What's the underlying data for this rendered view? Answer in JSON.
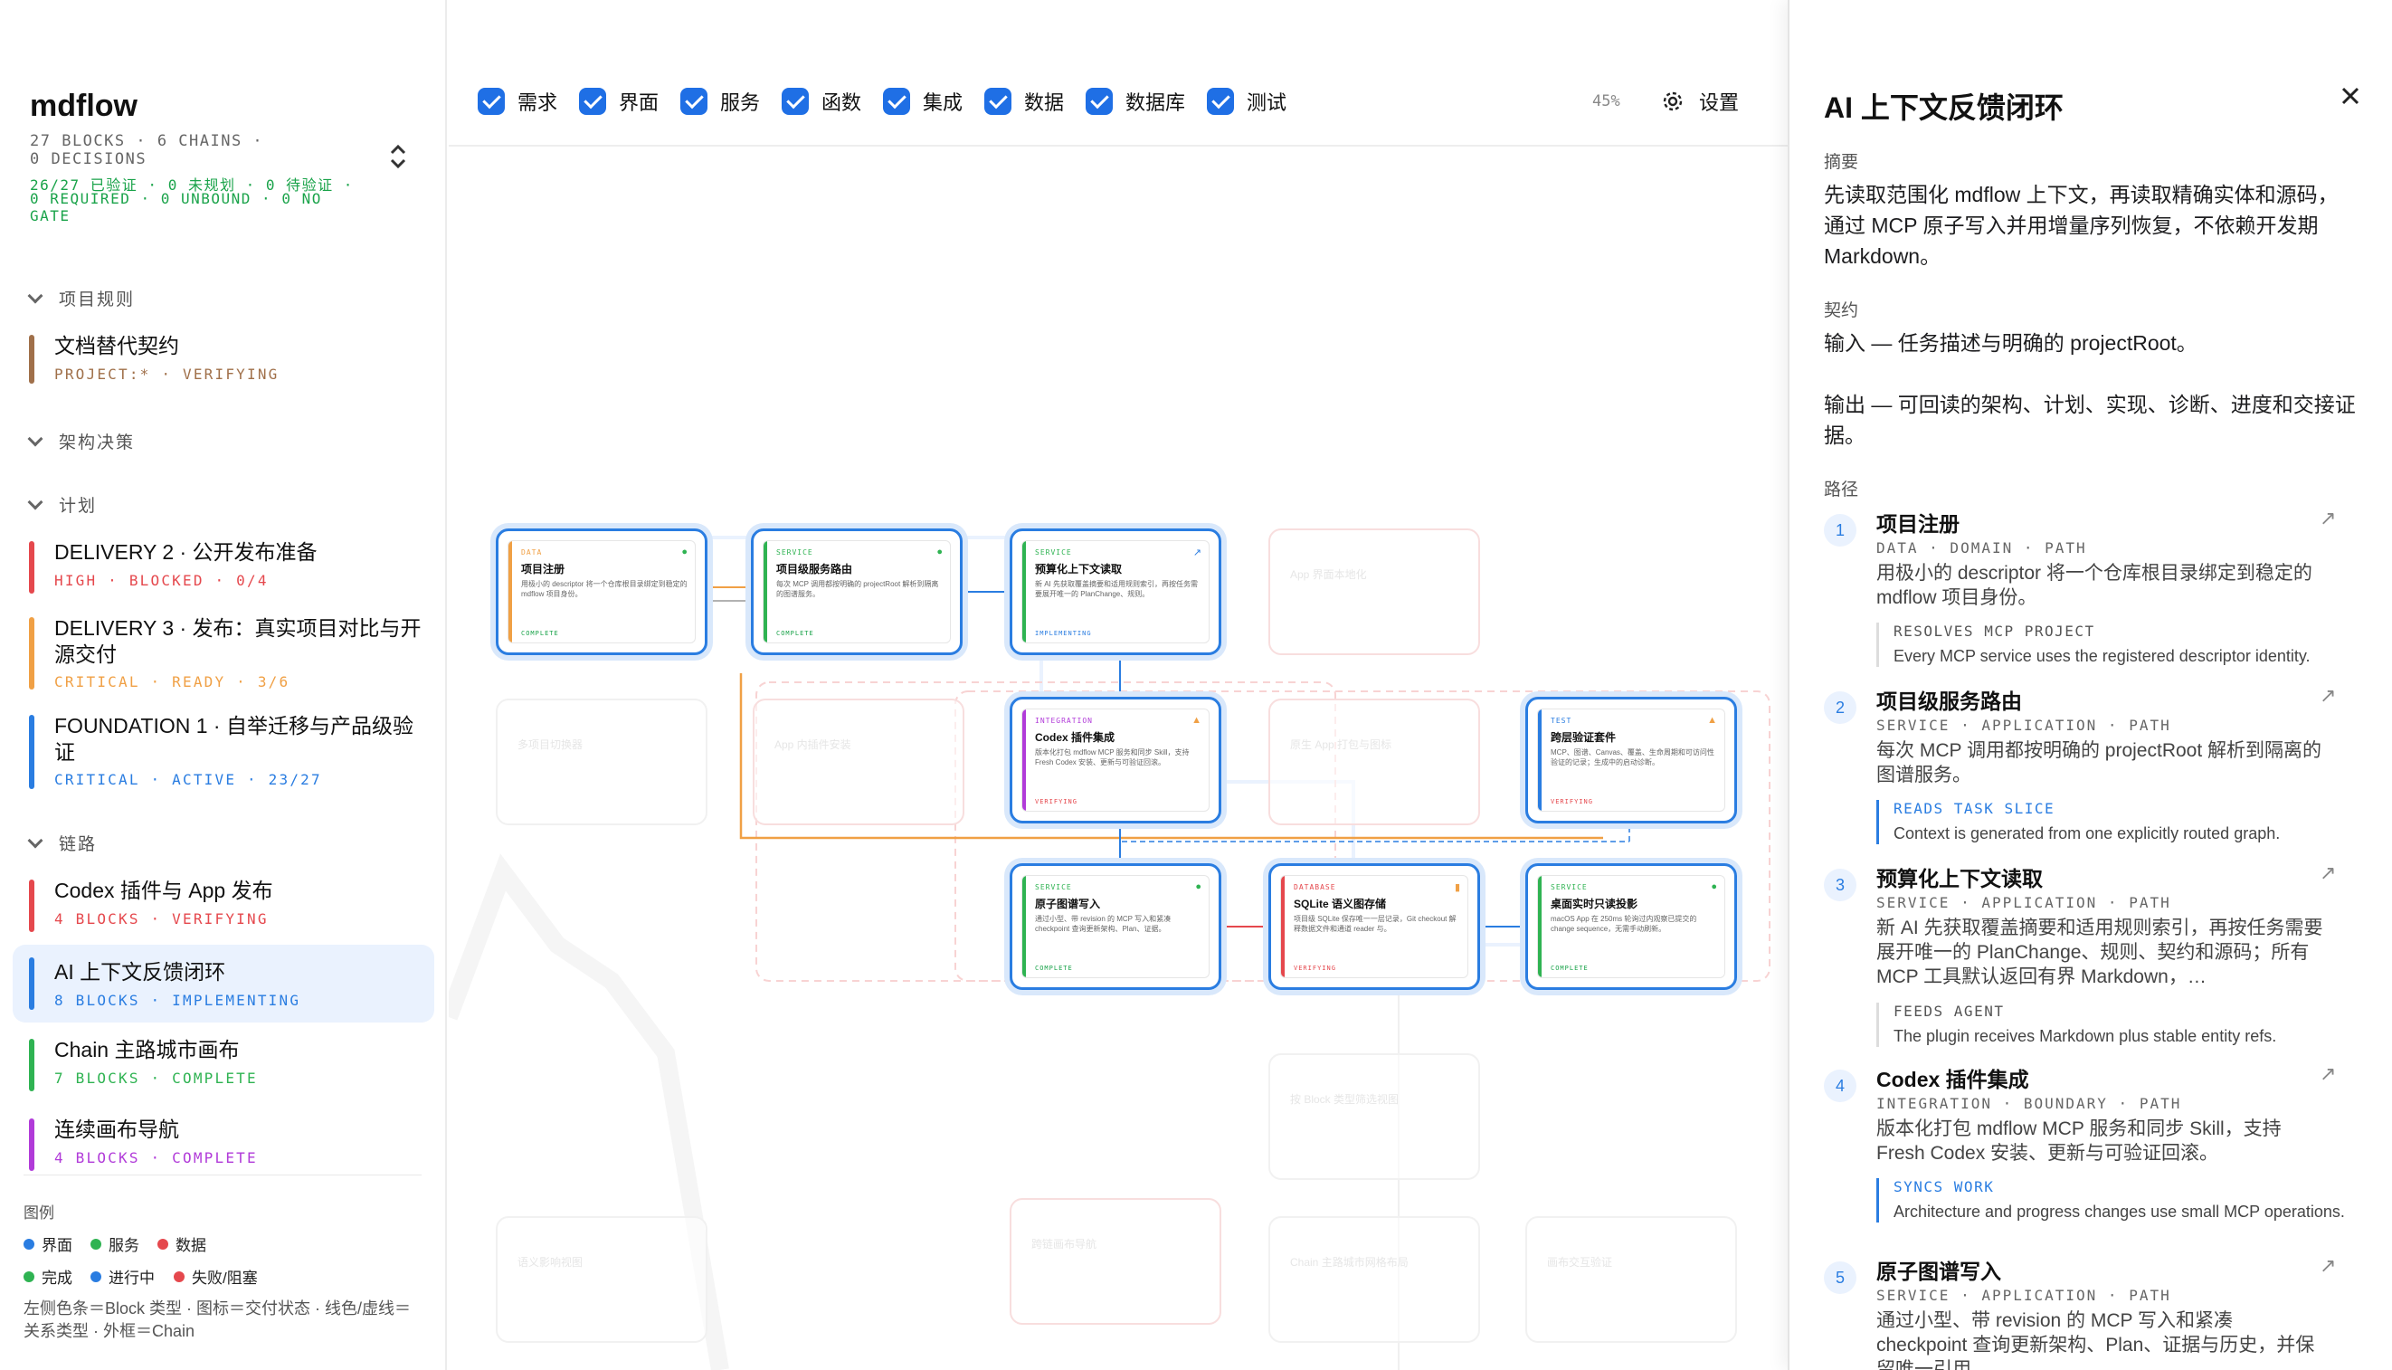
{
  "sidebar": {
    "title": "mdflow",
    "meta_line1": "27 BLOCKS · 6 CHAINS ·",
    "meta_line2": "0 DECISIONS",
    "status_line1": "26/27 已验证 · 0 未规划 · 0 待验证 ·",
    "status_line2": "0 REQUIRED · 0 UNBOUND · 0 NO",
    "status_line3": "GATE",
    "sections": {
      "rules": "项目规则",
      "decisions": "架构决策",
      "plan": "计划",
      "chains": "链路"
    },
    "rules_items": [
      {
        "title": "文档替代契约",
        "sub": "PROJECT:* · VERIFYING",
        "color": "#a0704a"
      }
    ],
    "plan_items": [
      {
        "title": "DELIVERY 2 · 公开发布准备",
        "sub": "HIGH · BLOCKED · 0/4",
        "color": "#e5484d"
      },
      {
        "title": "DELIVERY 3 · 发布：真实项目对比与开源交付",
        "sub": "CRITICAL · READY · 3/6",
        "color": "#f0a045"
      },
      {
        "title": "FOUNDATION 1 · 自举迁移与产品级验证",
        "sub": "CRITICAL · ACTIVE · 23/27",
        "color": "#2a7de1"
      }
    ],
    "chain_items": [
      {
        "title": "Codex 插件与 App 发布",
        "sub": "4 BLOCKS · VERIFYING",
        "color": "#e5484d"
      },
      {
        "title": "AI 上下文反馈闭环",
        "sub": "8 BLOCKS · IMPLEMENTING",
        "color": "#2a7de1"
      },
      {
        "title": "Chain 主路城市画布",
        "sub": "7 BLOCKS · COMPLETE",
        "color": "#2fb352"
      },
      {
        "title": "连续画布导航",
        "sub": "4 BLOCKS · COMPLETE",
        "color": "#b13bd9"
      }
    ],
    "legend": {
      "heading": "图例",
      "items": [
        {
          "label": "界面",
          "color": "#2a7de1"
        },
        {
          "label": "服务",
          "color": "#2fb352"
        },
        {
          "label": "数据",
          "color": "#e5484d"
        },
        {
          "label": "完成",
          "color": "#2fb352"
        },
        {
          "label": "进行中",
          "color": "#2a7de1"
        },
        {
          "label": "失败/阻塞",
          "color": "#e5484d"
        }
      ],
      "note": "左侧色条＝Block 类型 · 图标＝交付状态 · 线色/虚线＝关系类型 · 外框＝Chain"
    }
  },
  "toolbar": {
    "filters": [
      "需求",
      "界面",
      "服务",
      "函数",
      "集成",
      "数据",
      "数据库",
      "测试"
    ],
    "zoom": "45%",
    "settings_label": "设置"
  },
  "canvas": {
    "nodes": [
      {
        "type": "DATA",
        "name": "项目注册",
        "desc": "用极小的 descriptor 将一个仓库根目录绑定到稳定的 mdflow 项目身份。",
        "status": "COMPLETE",
        "color": "#f0a045"
      },
      {
        "type": "SERVICE",
        "name": "项目级服务路由",
        "desc": "每次 MCP 调用都按明确的 projectRoot 解析到隔离的图谱服务。",
        "status": "COMPLETE",
        "color": "#2fb352"
      },
      {
        "type": "SERVICE",
        "name": "预算化上下文读取",
        "desc": "新 AI 先获取覆盖摘要和适用规则索引，再按任务需要展开唯一的 PlanChange、规则。",
        "status": "IMPLEMENTING",
        "color": "#2fb352"
      },
      {
        "type": "INTEGRATION",
        "name": "Codex 插件集成",
        "desc": "版本化打包 mdflow MCP 服务和同步 Skill，支持 Fresh Codex 安装、更新与可验证回滚。",
        "status": "VERIFYING",
        "color": "#b13bd9"
      },
      {
        "type": "TEST",
        "name": "跨层验证套件",
        "desc": "MCP、图谱、Canvas、覆盖、生命周期和可访问性验证的记录；生成中的启动诊断。",
        "status": "VERIFYING",
        "color": "#2a7de1"
      },
      {
        "type": "SERVICE",
        "name": "原子图谱写入",
        "desc": "通过小型、带 revision 的 MCP 写入和紧凑 checkpoint 查询更新架构、Plan、证据。",
        "status": "COMPLETE",
        "color": "#2fb352"
      },
      {
        "type": "DATABASE",
        "name": "SQLite 语义图存储",
        "desc": "项目级 SQLite 保存唯一一层记录，Git checkout 解释数据文件和通道 reader 与。",
        "status": "VERIFYING",
        "color": "#e5484d"
      },
      {
        "type": "SERVICE",
        "name": "桌面实时只读投影",
        "desc": "macOS App 在 250ms 轮询过内观察已提交的 change sequence，无需手动刷新。",
        "status": "COMPLETE",
        "color": "#2fb352"
      }
    ]
  },
  "panel": {
    "title": "AI 上下文反馈闭环",
    "summary_label": "摘要",
    "summary": "先读取范围化 mdflow 上下文，再读取精确实体和源码，通过 MCP 原子写入并用增量序列恢复，不依赖开发期 Markdown。",
    "contract_label": "契约",
    "contract_in": "输入 — 任务描述与明确的 projectRoot。",
    "contract_out": "输出 — 可回读的架构、计划、实现、诊断、进度和交接证据。",
    "path_label": "路径",
    "steps": [
      {
        "num": "1",
        "name": "项目注册",
        "tag": "DATA · DOMAIN · PATH",
        "desc": "用极小的 descriptor 将一个仓库根目录绑定到稳定的 mdflow 项目身份。",
        "rel_key": "RESOLVES MCP PROJECT",
        "rel_val": "Every MCP service uses the registered descriptor identity.",
        "rel_color": "#555"
      },
      {
        "num": "2",
        "name": "项目级服务路由",
        "tag": "SERVICE · APPLICATION · PATH",
        "desc": "每次 MCP 调用都按明确的 projectRoot 解析到隔离的图谱服务。",
        "rel_key": "READS TASK SLICE",
        "rel_val": "Context is generated from one explicitly routed graph.",
        "rel_color": "#2a7de1"
      },
      {
        "num": "3",
        "name": "预算化上下文读取",
        "tag": "SERVICE · APPLICATION · PATH",
        "desc": "新 AI 先获取覆盖摘要和适用规则索引，再按任务需要展开唯一的 PlanChange、规则、契约和源码；所有 MCP 工具默认返回有界 Markdown，…",
        "rel_key": "FEEDS AGENT",
        "rel_val": "The plugin receives Markdown plus stable entity refs.",
        "rel_color": "#555"
      },
      {
        "num": "4",
        "name": "Codex 插件集成",
        "tag": "INTEGRATION · BOUNDARY · PATH",
        "desc": "版本化打包 mdflow MCP 服务和同步 Skill，支持 Fresh Codex 安装、更新与可验证回滚。",
        "rel_key": "SYNCS WORK",
        "rel_val": "Architecture and progress changes use small MCP operations.",
        "rel_color": "#2a7de1"
      },
      {
        "num": "5",
        "name": "原子图谱写入",
        "tag": "SERVICE · APPLICATION · PATH",
        "desc": "通过小型、带 revision 的 MCP 写入和紧凑 checkpoint 查询更新架构、Plan、证据与历史，并保留唯一引用",
        "rel_key": "",
        "rel_val": "",
        "rel_color": "#555"
      }
    ]
  }
}
